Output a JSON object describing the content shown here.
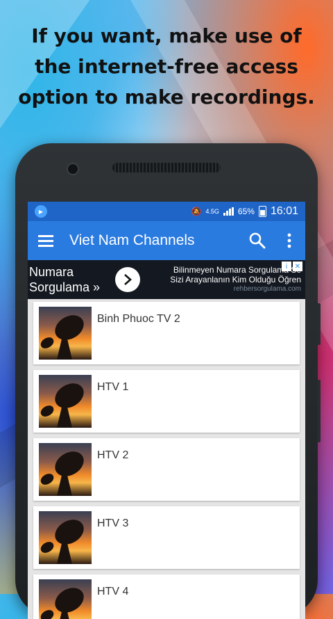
{
  "headline": {
    "line1": "If you want, make use of",
    "line2": "the internet-free access",
    "line3": "option to make recordings."
  },
  "status_bar": {
    "network": "4.5G",
    "battery": "65%",
    "time": "16:01"
  },
  "app_bar": {
    "title": "Viet Nam Channels",
    "menu_icon": "hamburger-menu-icon",
    "search_icon": "search-icon",
    "overflow_icon": "more-vertical-icon"
  },
  "ad": {
    "left_line1": "Numara",
    "left_line2": "Sorgulama »",
    "line1": "Bilinmeyen Numara Sorgulama Se",
    "line2": "Sizi Arayanlanın Kim Olduğu Öğren",
    "url": "rehbersorgulama.com"
  },
  "channels": [
    {
      "name": "Binh Phuoc TV 2"
    },
    {
      "name": "HTV 1"
    },
    {
      "name": "HTV 2"
    },
    {
      "name": "HTV 3"
    },
    {
      "name": "HTV 4"
    }
  ],
  "colors": {
    "status_bar": "#1f65c8",
    "app_bar": "#2a7be0",
    "ad_background": "#141820"
  }
}
